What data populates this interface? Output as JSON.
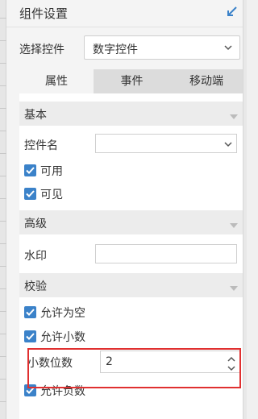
{
  "panel": {
    "title": "组件设置",
    "select_control_label": "选择控件",
    "select_control_value": "数字控件",
    "tabs": [
      {
        "label": "属性",
        "active": true
      },
      {
        "label": "事件",
        "active": false
      },
      {
        "label": "移动端",
        "active": false
      }
    ]
  },
  "basic": {
    "title": "基本",
    "widget_name_label": "控件名",
    "widget_name_value": "",
    "enabled_label": "可用",
    "enabled_checked": true,
    "visible_label": "可见",
    "visible_checked": true
  },
  "advanced": {
    "title": "高级",
    "watermark_label": "水印",
    "watermark_value": ""
  },
  "validation": {
    "title": "校验",
    "allow_empty_label": "允许为空",
    "allow_empty_checked": true,
    "allow_decimal_label": "允许小数",
    "allow_decimal_checked": true,
    "decimal_places_label": "小数位数",
    "decimal_places_value": "2",
    "allow_negative_label": "允许负数",
    "allow_negative_checked": true
  },
  "colors": {
    "checkbox": "#3b82c9",
    "highlight": "#e03030",
    "collapse_icon": "#3b82c9"
  },
  "icons": [
    "collapse-arrow-icon",
    "chevron-down-icon",
    "caret-down-icon",
    "check-icon",
    "spinner-up-icon",
    "spinner-down-icon"
  ]
}
